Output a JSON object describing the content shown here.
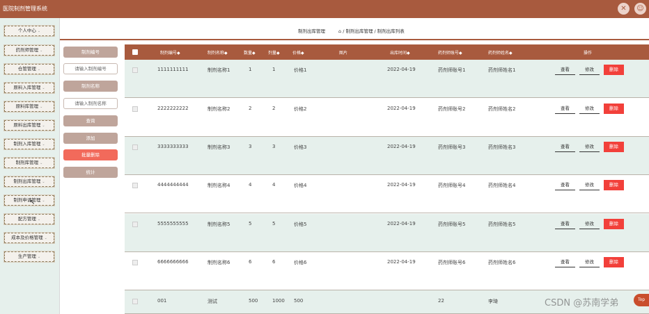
{
  "app": {
    "title": "医院制剂管理系统"
  },
  "top_icons": [
    "close-circle-icon",
    "user-circle-icon"
  ],
  "sidebar": {
    "items": [
      {
        "label": "个人中心"
      },
      {
        "label": "药剂师管理"
      },
      {
        "label": "仓管管理"
      },
      {
        "label": "原料入库管理"
      },
      {
        "label": "原料库管理"
      },
      {
        "label": "原料出库管理"
      },
      {
        "label": "制剂入库管理"
      },
      {
        "label": "制剂库管理"
      },
      {
        "label": "制剂出库管理"
      },
      {
        "label": "制剂申请管理"
      },
      {
        "label": "配方管理"
      },
      {
        "label": "成本及价格管理"
      },
      {
        "label": "生产管理"
      }
    ]
  },
  "header": {
    "title": "制剂出库管理",
    "breadcrumb": "⌂ / 制剂出库管理 / 制剂出库列表"
  },
  "filters": {
    "code_label": "制剂编号",
    "code_placeholder": "请输入制剂编号",
    "name_label": "制剂名称",
    "name_placeholder": "请输入制剂名称",
    "query": "查询",
    "add": "添加",
    "batch_delete": "批量删除",
    "stats": "统计"
  },
  "table": {
    "headers": [
      "制剂编号◆",
      "制剂名称◆",
      "数量◆",
      "剂量◆",
      "价格◆",
      "图片",
      "出库时间◆",
      "药剂师账号◆",
      "药剂师姓名◆",
      "操作"
    ],
    "actions": {
      "view": "查看",
      "edit": "修改",
      "delete": "删除"
    },
    "rows": [
      {
        "code": "1111111111",
        "name": "制剂名称1",
        "qty": "1",
        "dose": "1",
        "price": "价格1",
        "time": "2022-04-19",
        "acct": "药剂师账号1",
        "pname": "药剂师姓名1"
      },
      {
        "code": "2222222222",
        "name": "制剂名称2",
        "qty": "2",
        "dose": "2",
        "price": "价格2",
        "time": "2022-04-19",
        "acct": "药剂师账号2",
        "pname": "药剂师姓名2"
      },
      {
        "code": "3333333333",
        "name": "制剂名称3",
        "qty": "3",
        "dose": "3",
        "price": "价格3",
        "time": "2022-04-19",
        "acct": "药剂师账号3",
        "pname": "药剂师姓名3"
      },
      {
        "code": "4444444444",
        "name": "制剂名称4",
        "qty": "4",
        "dose": "4",
        "price": "价格4",
        "time": "2022-04-19",
        "acct": "药剂师账号4",
        "pname": "药剂师姓名4"
      },
      {
        "code": "5555555555",
        "name": "制剂名称5",
        "qty": "5",
        "dose": "5",
        "price": "价格5",
        "time": "2022-04-19",
        "acct": "药剂师账号5",
        "pname": "药剂师姓名5"
      },
      {
        "code": "6666666666",
        "name": "制剂名称6",
        "qty": "6",
        "dose": "6",
        "price": "价格6",
        "time": "2022-04-19",
        "acct": "药剂师账号6",
        "pname": "药剂师姓名6"
      },
      {
        "code": "001",
        "name": "测试",
        "qty": "500",
        "dose": "1000",
        "price": "500",
        "time": "",
        "acct": "22",
        "pname": "李琦"
      }
    ]
  },
  "watermark": "CSDN @苏南学弟",
  "top_badge": "Top",
  "colors": {
    "brand": "#a85a3e",
    "mint": "#e6f0ec",
    "delete": "#f2403a",
    "batch_delete": "#f26a5b"
  }
}
